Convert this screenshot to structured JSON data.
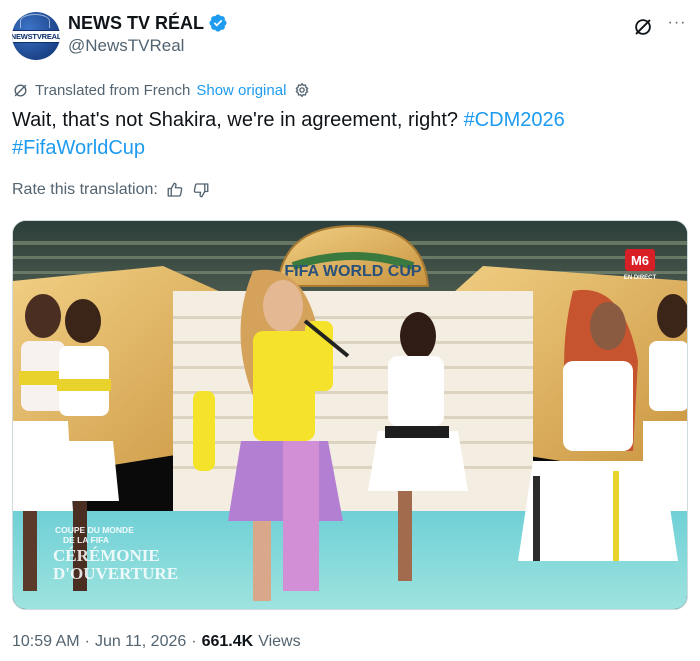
{
  "author": {
    "display_name": "NEWS TV RÉAL",
    "handle": "@NewsTVReal",
    "avatar_text": "NEWSTVREAL",
    "verified": true
  },
  "translation": {
    "label": "Translated from French",
    "show_original": "Show original"
  },
  "tweet": {
    "text": "Wait, that's not Shakira, we're in agreement, right?",
    "hashtags": [
      "#CDM2026",
      "#FifaWorldCup"
    ]
  },
  "rate": {
    "label": "Rate this translation:"
  },
  "media": {
    "description": "Ceremony video still",
    "overlay_text": [
      "COUPE DU MONDE",
      "DE LA FIFA",
      "CÉRÉMONIE",
      "D'OUVERTURE"
    ],
    "trophy_text": "FIFA WORLD CUP",
    "channel_logo": "M6",
    "channel_sub": "EN DIRECT"
  },
  "meta": {
    "time": "10:59 AM",
    "date": "Jun 11, 2026",
    "views_count": "661.4K",
    "views_label": "Views",
    "separator": "·"
  },
  "colors": {
    "accent": "#1d9bf0",
    "text": "#0f1419",
    "muted": "#536471"
  }
}
